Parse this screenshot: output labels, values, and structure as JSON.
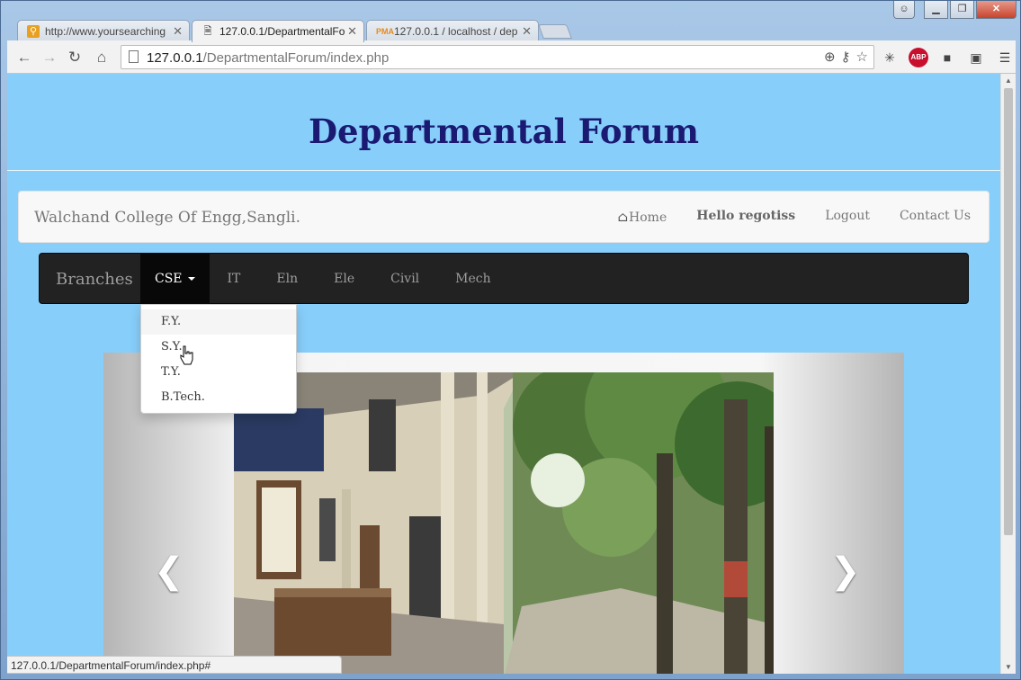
{
  "browser": {
    "tabs": [
      {
        "title": "http://www.yoursearching",
        "icon": "search-favicon"
      },
      {
        "title": "127.0.0.1/DepartmentalFo",
        "icon": "page-favicon"
      },
      {
        "title": "127.0.0.1 / localhost / dep",
        "icon": "pma-favicon"
      }
    ],
    "url_host": "127.0.0.1",
    "url_path": "/DepartmentalForum/index.php",
    "status_text": "127.0.0.1/DepartmentalForum/index.php#",
    "abp_label": "ABP"
  },
  "site": {
    "title": "Departmental Forum",
    "college": "Walchand College Of Engg,Sangli.",
    "top_links": {
      "home": "Home",
      "greeting": "Hello regotiss",
      "logout": "Logout",
      "contact": "Contact Us"
    },
    "branch_nav": {
      "brand": "Branches",
      "items": [
        "CSE",
        "IT",
        "Eln",
        "Ele",
        "Civil",
        "Mech"
      ],
      "active": "CSE"
    },
    "dropdown": [
      "F.Y.",
      "S.Y.",
      "T.Y.",
      "B.Tech."
    ]
  },
  "colors": {
    "page_bg": "#87cefa",
    "title": "#1a1a72",
    "navbar_dark": "#222222"
  }
}
